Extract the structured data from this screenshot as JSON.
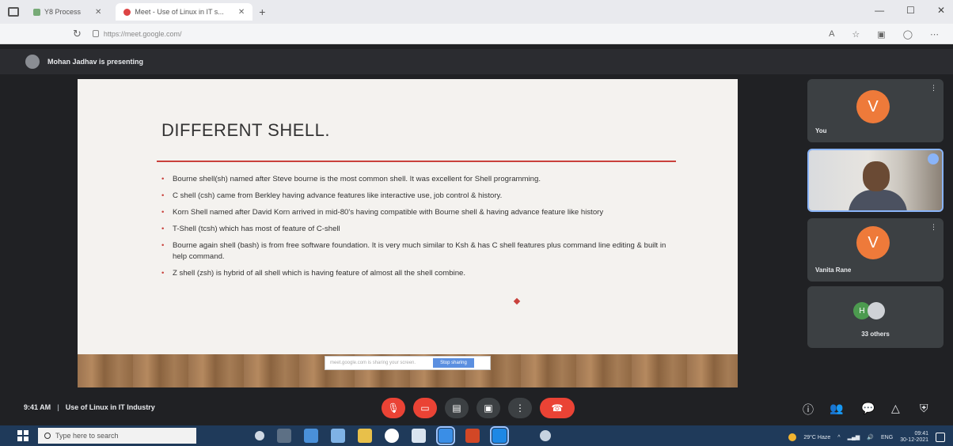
{
  "browser": {
    "tabs": [
      {
        "label": "Y8 Process"
      },
      {
        "label": "Meet - Use of Linux in IT s..."
      }
    ],
    "url": "https://meet.google.com/"
  },
  "meet": {
    "presenting_text": "Mohan Jadhav is presenting",
    "slide": {
      "title": "DIFFERENT SHELL.",
      "bullets": [
        "Bourne shell(sh) named after Steve bourne is the most common shell. It was excellent for Shell programming.",
        "C shell (csh) came from Berkley having advance features like interactive use, job control & history.",
        "Korn Shell named after David Korn arrived in mid-80's having compatible with Bourne shell & having advance feature like history",
        "T-Shell (tcsh) which has most of feature of C-shell",
        "Bourne again shell (bash) is from free software foundation. It is very much similar to Ksh & has C shell features plus command line editing & built in help command.",
        "Z shell (zsh) is hybrid of all shell which is having feature of almost all the shell combine."
      ],
      "toolbar_hint": "meet.google.com is sharing your screen.",
      "toolbar_button": "Stop sharing"
    },
    "participants": {
      "you": {
        "initial": "V",
        "name": "You"
      },
      "vanita": {
        "initial": "V",
        "name": "Vanita Rane"
      },
      "others": {
        "initial": "H",
        "label": "33 others"
      }
    },
    "meeting_time": "9:41 AM",
    "meeting_title": "Use of Linux in IT Industry"
  },
  "taskbar": {
    "search_placeholder": "Type here to search",
    "weather": "29°C Haze",
    "time": "09:41",
    "date": "30-12-2021"
  }
}
